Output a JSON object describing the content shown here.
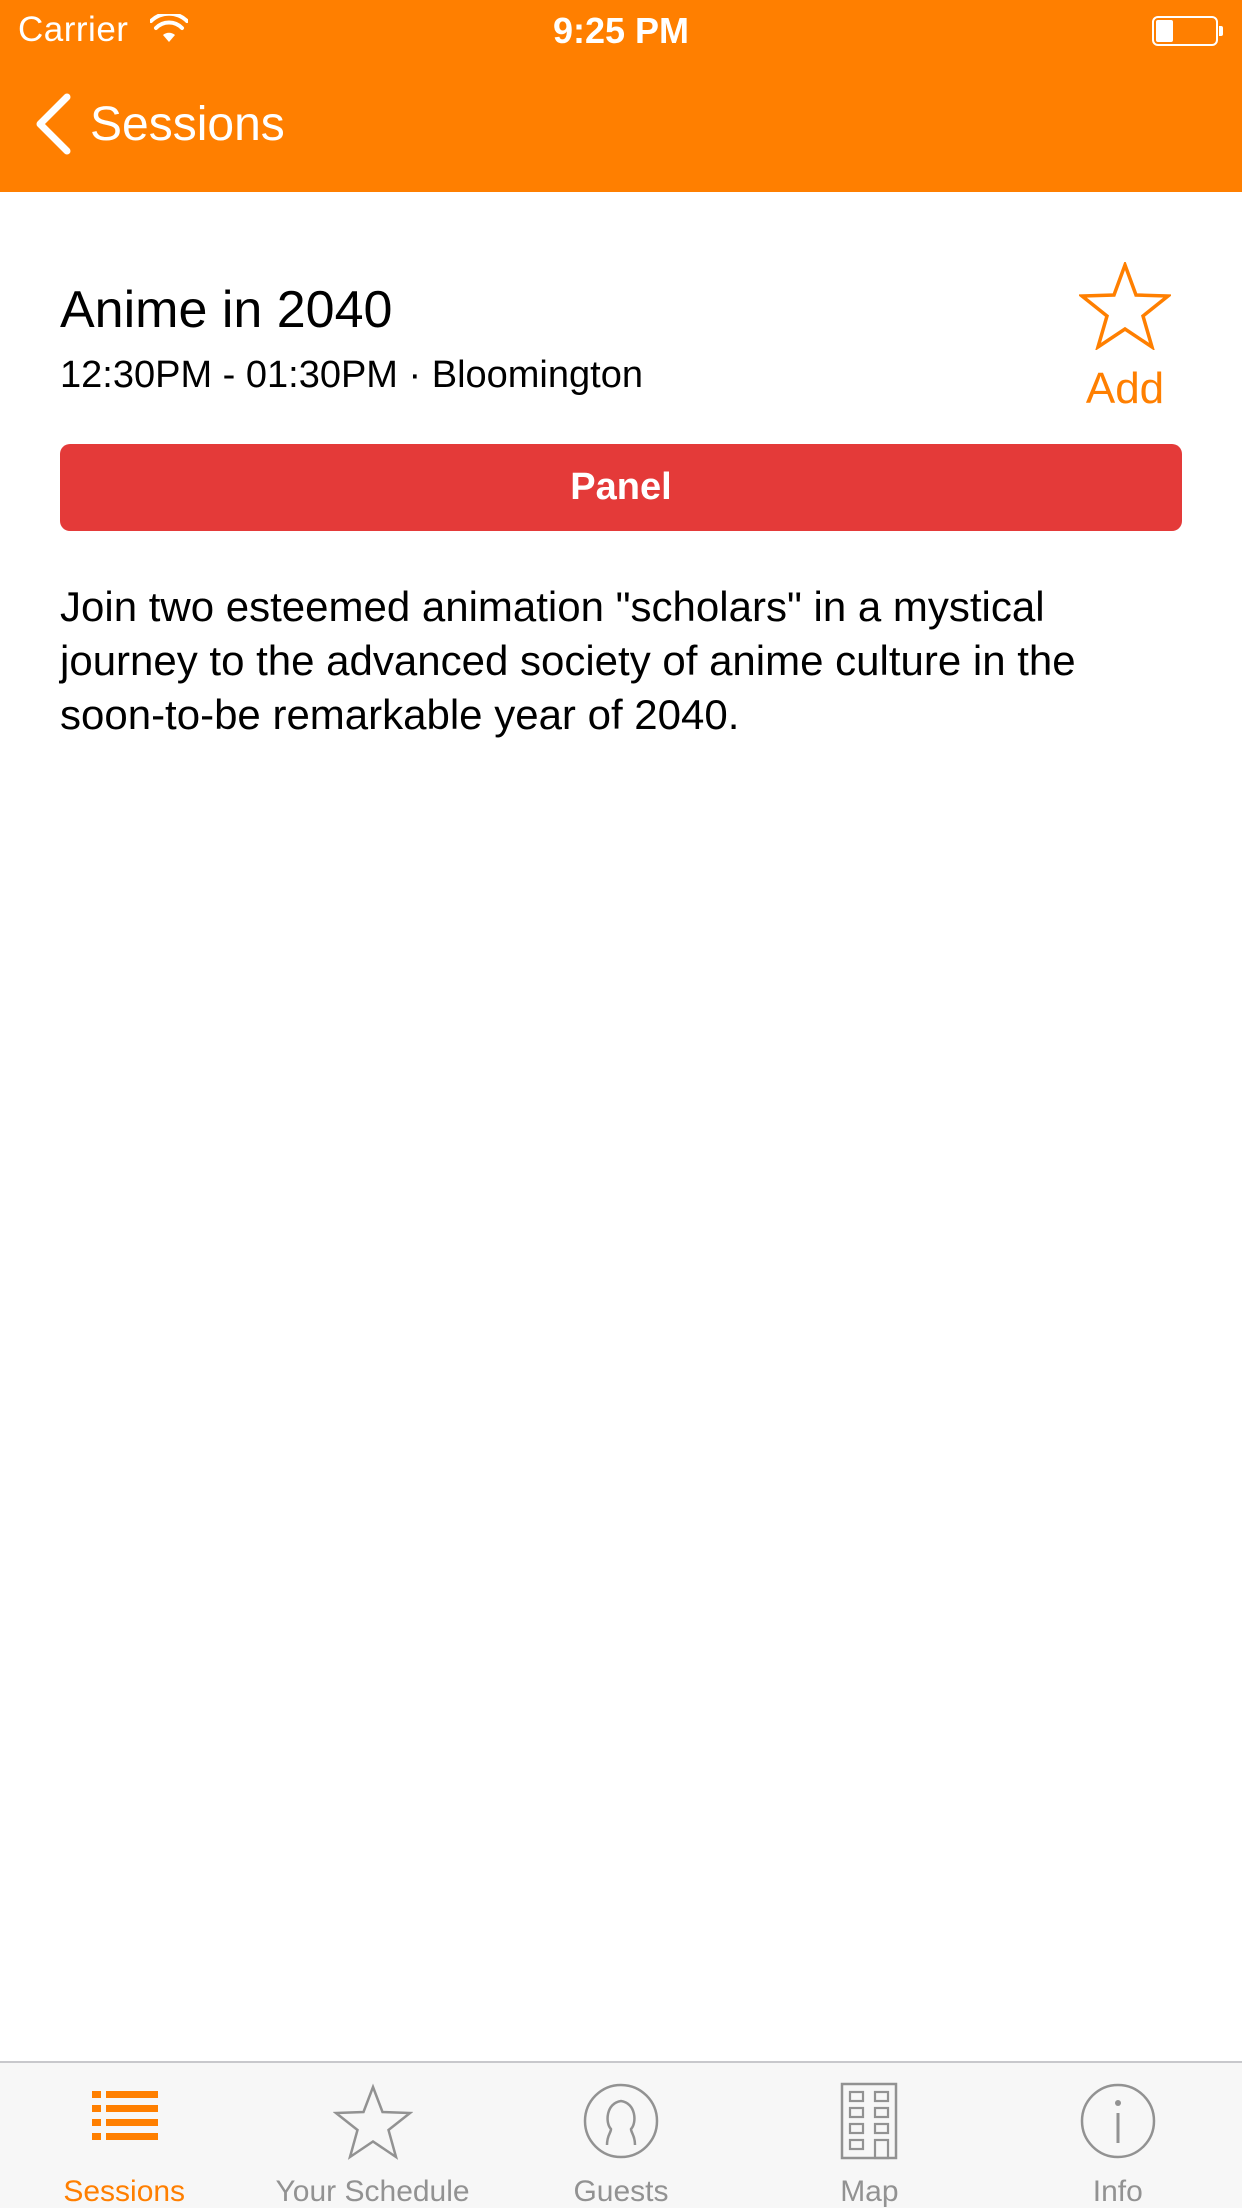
{
  "status_bar": {
    "carrier": "Carrier",
    "time": "9:25 PM",
    "battery_level": 0.3
  },
  "nav": {
    "back_label": "Sessions"
  },
  "session": {
    "title": "Anime in 2040",
    "meta": "12:30PM - 01:30PM · Bloomington",
    "add_label": "Add",
    "type_label": "Panel",
    "description": "Join two esteemed animation \"scholars\" in a mystical journey to the advanced society of anime culture in the soon-to-be remarkable year of 2040."
  },
  "tabs": [
    {
      "label": "Sessions",
      "icon": "list-icon",
      "active": true
    },
    {
      "label": "Your Schedule",
      "icon": "star-icon",
      "active": false
    },
    {
      "label": "Guests",
      "icon": "person-icon",
      "active": false
    },
    {
      "label": "Map",
      "icon": "building-icon",
      "active": false
    },
    {
      "label": "Info",
      "icon": "info-icon",
      "active": false
    }
  ],
  "colors": {
    "accent": "#ff7f00",
    "panel_badge": "#e43a39",
    "tab_inactive": "#929292",
    "tab_bar_bg": "#f7f7f7"
  }
}
